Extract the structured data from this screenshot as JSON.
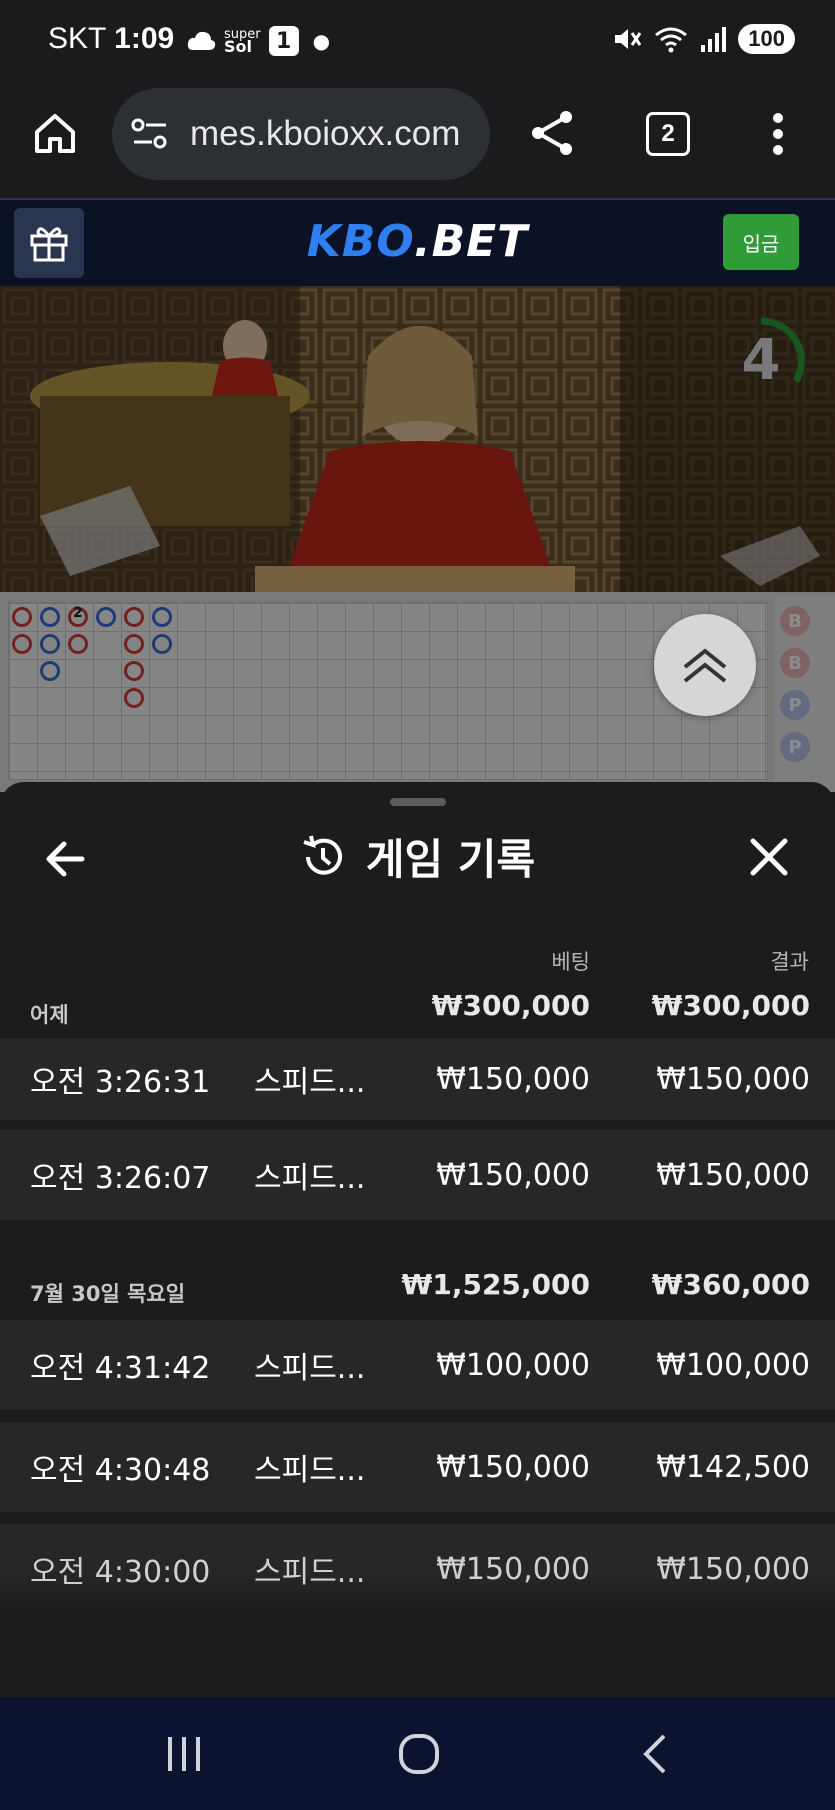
{
  "status_bar": {
    "carrier": "SKT",
    "time": "1:09",
    "super_badge_top": "super",
    "super_badge_bottom": "Sol",
    "notification_count": "1",
    "battery": "100"
  },
  "browser": {
    "url": "mes.kboioxx.com",
    "tab_count": "2"
  },
  "site": {
    "logo_part1": "KBO",
    "logo_part2": ".BET",
    "deposit_label": "입금"
  },
  "video": {
    "countdown": "4"
  },
  "roadmap": {
    "side_labels": [
      "B",
      "B",
      "P",
      "P"
    ],
    "tie_count": "2"
  },
  "sheet": {
    "title": "게임 기록",
    "col_bet": "베팅",
    "col_result": "결과",
    "groups": [
      {
        "date": "어제",
        "bet_total": "₩300,000",
        "result_total": "₩300,000",
        "rows": [
          {
            "time": "오전 3:26:31",
            "game": "스피드...",
            "bet": "₩150,000",
            "result": "₩150,000"
          },
          {
            "time": "오전 3:26:07",
            "game": "스피드...",
            "bet": "₩150,000",
            "result": "₩150,000"
          }
        ]
      },
      {
        "date": "7월 30일 목요일",
        "bet_total": "₩1,525,000",
        "result_total": "₩360,000",
        "rows": [
          {
            "time": "오전 4:31:42",
            "game": "스피드...",
            "bet": "₩100,000",
            "result": "₩100,000"
          },
          {
            "time": "오전 4:30:48",
            "game": "스피드...",
            "bet": "₩150,000",
            "result": "₩142,500"
          },
          {
            "time": "오전 4:30:00",
            "game": "스피드...",
            "bet": "₩150,000",
            "result": "₩150,000"
          }
        ]
      }
    ]
  },
  "colors": {
    "accent_blue": "#2f7ff0",
    "deposit_green": "#2f9c38",
    "timer_green": "#2f9c38",
    "sheet_bg": "#1c1c1e",
    "row_bg": "#27272a"
  },
  "icons": [
    "home-icon",
    "site-settings-icon",
    "share-icon",
    "tabs-icon",
    "more-icon",
    "gift-icon",
    "chevron-up-icon",
    "back-arrow-icon",
    "history-icon",
    "close-icon",
    "recent-apps-icon",
    "home-nav-icon",
    "back-nav-icon"
  ]
}
